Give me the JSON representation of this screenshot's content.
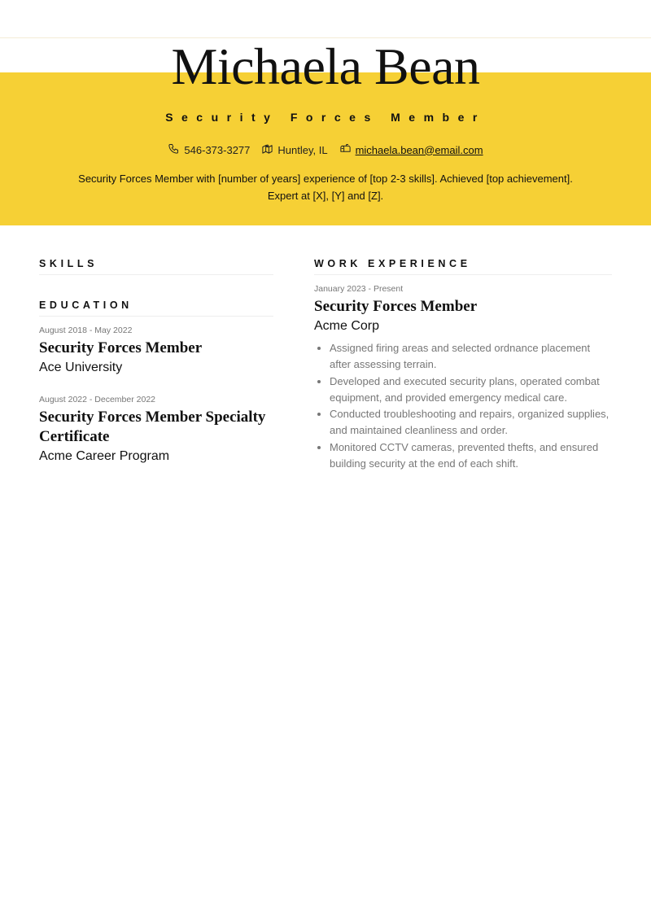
{
  "header": {
    "name": "Michaela Bean",
    "role": "Security Forces Member",
    "contacts": {
      "phone": {
        "icon": "phone-icon",
        "text": "546-373-3277"
      },
      "location": {
        "icon": "map-icon",
        "text": "Huntley, IL"
      },
      "email": {
        "icon": "mailbox-icon",
        "text": "michaela.bean@email.com"
      }
    },
    "summary": "Security Forces Member with [number of years] experience of [top 2-3 skills]. Achieved [top achievement]. Expert at [X], [Y] and [Z]."
  },
  "colors": {
    "band": "#f6d035",
    "text": "#111111",
    "muted": "#777777"
  },
  "skills": {
    "title": "SKILLS"
  },
  "education": {
    "title": "EDUCATION",
    "entries": [
      {
        "date": "August 2018 - May 2022",
        "title": "Security Forces Member",
        "org": "Ace University"
      },
      {
        "date": "August 2022 - December 2022",
        "title": "Security Forces Member Specialty Certificate",
        "org": "Acme Career Program"
      }
    ]
  },
  "work": {
    "title": "WORK EXPERIENCE",
    "entries": [
      {
        "date": "January 2023 - Present",
        "title": "Security Forces Member",
        "org": "Acme Corp",
        "bullets": [
          "Assigned firing areas and selected ordnance placement after assessing terrain.",
          "Developed and executed security plans, operated combat equipment, and provided emergency medical care.",
          "Conducted troubleshooting and repairs, organized supplies, and maintained cleanliness and order.",
          "Monitored CCTV cameras, prevented thefts, and ensured building security at the end of each shift."
        ]
      }
    ]
  }
}
